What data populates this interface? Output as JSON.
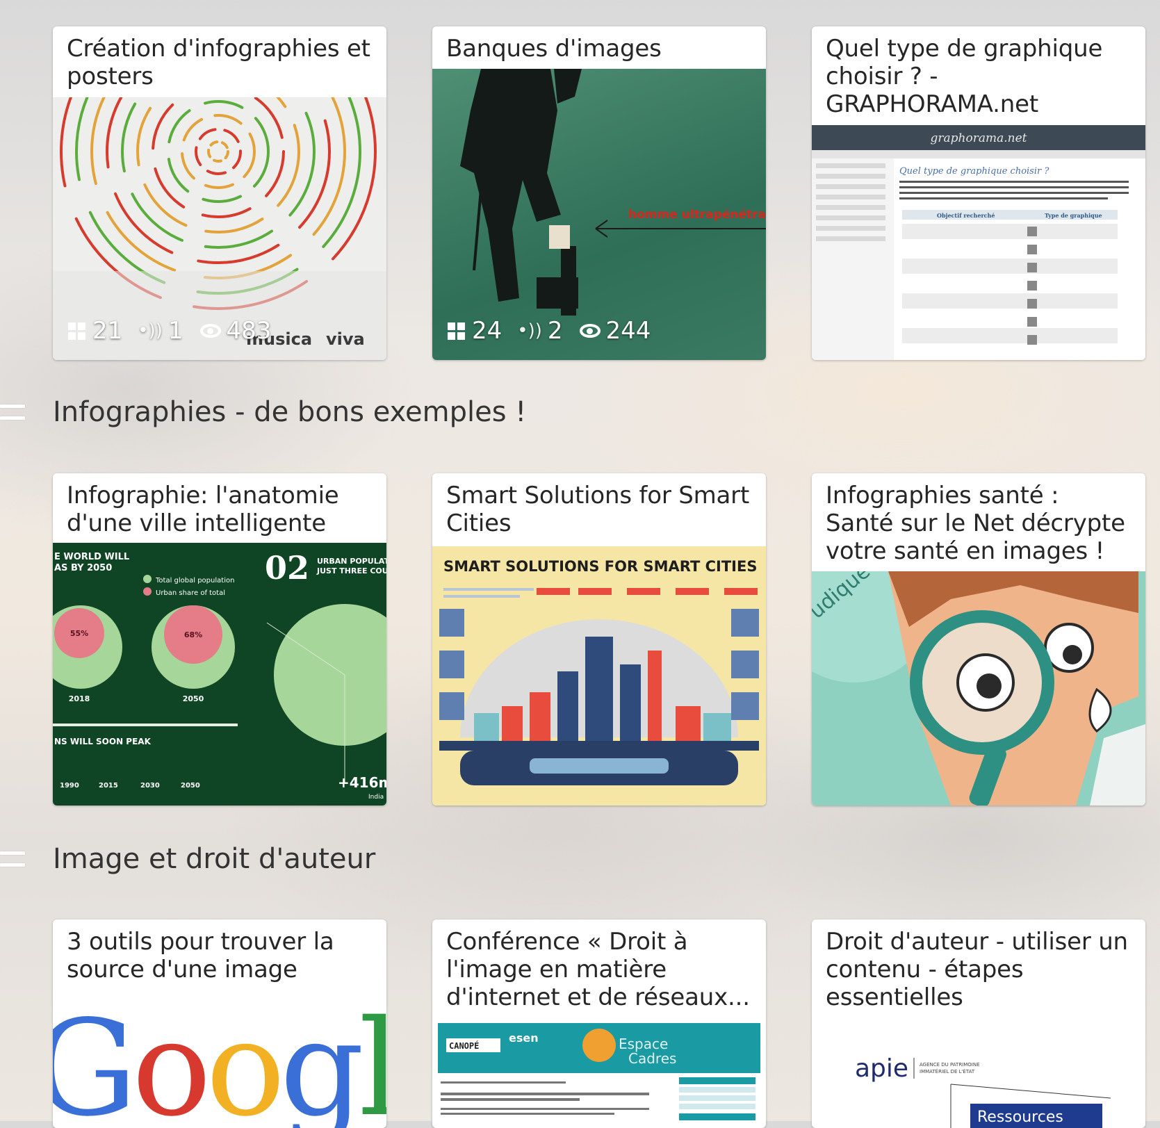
{
  "row1": [
    {
      "title": "Création d'infographies et posters",
      "stats": {
        "scoops": "21",
        "comments": "1",
        "views": "483"
      },
      "thumb_text": [
        "musica",
        "viva"
      ]
    },
    {
      "title": "Banques d'images",
      "stats": {
        "scoops": "24",
        "comments": "2",
        "views": "244"
      },
      "thumb_text": [
        "homme ultrapénétrant"
      ]
    },
    {
      "title": "Quel type de graphique choisir ? - GRAPHORAMA.net",
      "thumb_text": [
        "graphorama.net",
        "Quel type de graphique choisir ?",
        "Objectif recherché",
        "Type de graphique"
      ]
    }
  ],
  "section1": "Infographies - de bons exemples !",
  "row2": [
    {
      "title": "Infographie: l'anatomie d'une ville intelligente",
      "thumb_text": [
        "E WORLD WILL",
        "AS BY 2050",
        "Total global population",
        "Urban share of total",
        "55%",
        "68%",
        "2018",
        "2050",
        "02",
        "URBAN POPULATI",
        "JUST THREE COU",
        "NS WILL SOON PEAK",
        "1990",
        "2015",
        "2030",
        "2050",
        "+416m",
        "India"
      ]
    },
    {
      "title": "Smart Solutions for Smart Cities",
      "thumb_text": [
        "SMART SOLUTIONS FOR SMART CITIES"
      ]
    },
    {
      "title": "Infographies santé : Santé sur le Net décrypte votre santé en images !",
      "thumb_text": [
        "udique"
      ]
    }
  ],
  "section2": "Image et droit d'auteur",
  "row3": [
    {
      "title": "3 outils pour trouver la source d'une image",
      "thumb_text": [
        "Googl"
      ]
    },
    {
      "title": "Conférence « Droit à l'image en matière d'internet et de réseaux...",
      "thumb_text": [
        "CANOPÉ",
        "esen",
        "Espace",
        "Cadres"
      ]
    },
    {
      "title": "Droit d'auteur - utiliser un contenu - étapes essentielles",
      "thumb_text": [
        "apie",
        "AGENCE DU PATRIMOINE",
        "IMMATÉRIEL DE L'ÉTAT",
        "Ressources"
      ]
    }
  ],
  "colors": {
    "card_bg": "#ffffff",
    "title_text": "#262626",
    "section_text": "#333333",
    "graphorama_bar": "#3d4a55",
    "smart_bg": "#f5e6a6",
    "health_bg": "#8ed1c0",
    "city_bg": "#0f4524"
  }
}
